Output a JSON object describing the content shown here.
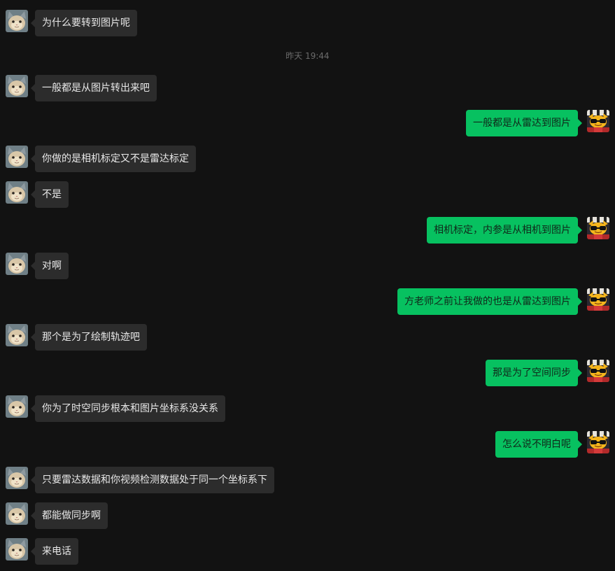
{
  "timestamp": "昨天 19:44",
  "messages": [
    {
      "side": "left",
      "text": "为什么要转到图片呢"
    },
    {
      "side": "left",
      "text": "一般都是从图片转出来吧"
    },
    {
      "side": "right",
      "text": "一般都是从雷达到图片"
    },
    {
      "side": "left",
      "text": "你做的是相机标定又不是雷达标定"
    },
    {
      "side": "left",
      "text": "不是"
    },
    {
      "side": "right",
      "text": "相机标定，内参是从相机到图片"
    },
    {
      "side": "left",
      "text": "对啊"
    },
    {
      "side": "right",
      "text": "方老师之前让我做的也是从雷达到图片"
    },
    {
      "side": "left",
      "text": "那个是为了绘制轨迹吧"
    },
    {
      "side": "right",
      "text": "那是为了空间同步"
    },
    {
      "side": "left",
      "text": "你为了时空同步根本和图片坐标系没关系"
    },
    {
      "side": "right",
      "text": "怎么说不明白呢"
    },
    {
      "side": "left",
      "text": "只要雷达数据和你视频检测数据处于同一个坐标系下"
    },
    {
      "side": "left",
      "text": "都能做同步啊"
    },
    {
      "side": "left",
      "text": "来电话"
    }
  ],
  "avatars": {
    "left": "cat-avatar-icon",
    "right": "cartoon-avatar-icon"
  },
  "colors": {
    "background": "#121212",
    "incoming_bubble": "#2c2c2c",
    "outgoing_bubble": "#07c160"
  }
}
